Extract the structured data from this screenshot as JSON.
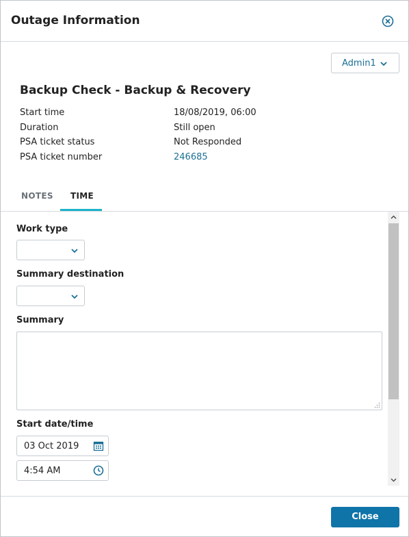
{
  "dialog": {
    "title": "Outage Information",
    "close_icon": "close-circle-icon"
  },
  "user_menu": {
    "label": "Admin1",
    "icon": "chevron-down-icon"
  },
  "check": {
    "title": "Backup Check - Backup & Recovery",
    "details": [
      {
        "label": "Start time",
        "value": "18/08/2019, 06:00"
      },
      {
        "label": "Duration",
        "value": "Still open"
      },
      {
        "label": "PSA ticket status",
        "value": "Not Responded"
      },
      {
        "label": "PSA ticket number",
        "value": "246685"
      }
    ]
  },
  "tabs": [
    {
      "label": "NOTES",
      "active": false
    },
    {
      "label": "TIME",
      "active": true
    }
  ],
  "form": {
    "work_type_label": "Work type",
    "work_type_value": "",
    "summary_destination_label": "Summary destination",
    "summary_destination_value": "",
    "summary_label": "Summary",
    "summary_value": "",
    "start_datetime_label": "Start date/time",
    "start_date": "03 Oct 2019",
    "start_time": "4:54 AM"
  },
  "footer": {
    "close_label": "Close"
  },
  "colors": {
    "accent": "#0f74a8",
    "link": "#1a6f96",
    "tab_underline": "#1ab3c9"
  }
}
